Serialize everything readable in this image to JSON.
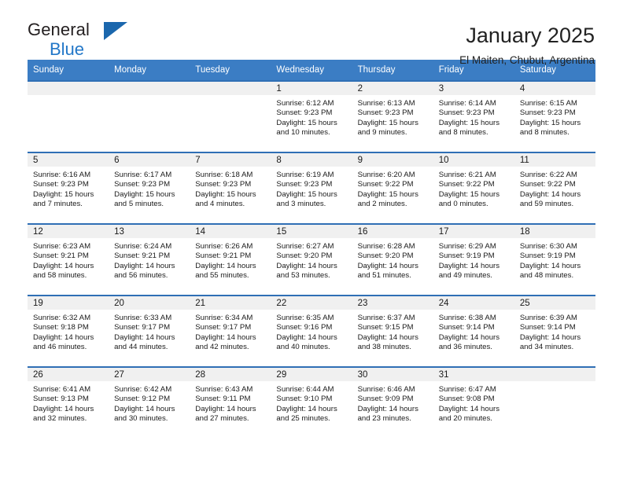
{
  "brand": {
    "name_top": "General",
    "name_bottom": "Blue",
    "triangle_color": "#1b67ad",
    "blue_text_color": "#2277c8"
  },
  "header": {
    "title": "January 2025",
    "subtitle": "El Maiten, Chubut, Argentina"
  },
  "theme": {
    "header_bg": "#3b7dc4",
    "row_border": "#2f6fb5",
    "day_strip_bg": "#f0f0f0"
  },
  "weekdays": [
    "Sunday",
    "Monday",
    "Tuesday",
    "Wednesday",
    "Thursday",
    "Friday",
    "Saturday"
  ],
  "labels": {
    "sunrise": "Sunrise:",
    "sunset": "Sunset:",
    "daylight": "Daylight:"
  },
  "weeks": [
    [
      {
        "day": "",
        "empty": true
      },
      {
        "day": "",
        "empty": true
      },
      {
        "day": "",
        "empty": true
      },
      {
        "day": "1",
        "sunrise": "Sunrise: 6:12 AM",
        "sunset": "Sunset: 9:23 PM",
        "daylight_line1": "Daylight: 15 hours",
        "daylight_line2": "and 10 minutes."
      },
      {
        "day": "2",
        "sunrise": "Sunrise: 6:13 AM",
        "sunset": "Sunset: 9:23 PM",
        "daylight_line1": "Daylight: 15 hours",
        "daylight_line2": "and 9 minutes."
      },
      {
        "day": "3",
        "sunrise": "Sunrise: 6:14 AM",
        "sunset": "Sunset: 9:23 PM",
        "daylight_line1": "Daylight: 15 hours",
        "daylight_line2": "and 8 minutes."
      },
      {
        "day": "4",
        "sunrise": "Sunrise: 6:15 AM",
        "sunset": "Sunset: 9:23 PM",
        "daylight_line1": "Daylight: 15 hours",
        "daylight_line2": "and 8 minutes."
      }
    ],
    [
      {
        "day": "5",
        "sunrise": "Sunrise: 6:16 AM",
        "sunset": "Sunset: 9:23 PM",
        "daylight_line1": "Daylight: 15 hours",
        "daylight_line2": "and 7 minutes."
      },
      {
        "day": "6",
        "sunrise": "Sunrise: 6:17 AM",
        "sunset": "Sunset: 9:23 PM",
        "daylight_line1": "Daylight: 15 hours",
        "daylight_line2": "and 5 minutes."
      },
      {
        "day": "7",
        "sunrise": "Sunrise: 6:18 AM",
        "sunset": "Sunset: 9:23 PM",
        "daylight_line1": "Daylight: 15 hours",
        "daylight_line2": "and 4 minutes."
      },
      {
        "day": "8",
        "sunrise": "Sunrise: 6:19 AM",
        "sunset": "Sunset: 9:23 PM",
        "daylight_line1": "Daylight: 15 hours",
        "daylight_line2": "and 3 minutes."
      },
      {
        "day": "9",
        "sunrise": "Sunrise: 6:20 AM",
        "sunset": "Sunset: 9:22 PM",
        "daylight_line1": "Daylight: 15 hours",
        "daylight_line2": "and 2 minutes."
      },
      {
        "day": "10",
        "sunrise": "Sunrise: 6:21 AM",
        "sunset": "Sunset: 9:22 PM",
        "daylight_line1": "Daylight: 15 hours",
        "daylight_line2": "and 0 minutes."
      },
      {
        "day": "11",
        "sunrise": "Sunrise: 6:22 AM",
        "sunset": "Sunset: 9:22 PM",
        "daylight_line1": "Daylight: 14 hours",
        "daylight_line2": "and 59 minutes."
      }
    ],
    [
      {
        "day": "12",
        "sunrise": "Sunrise: 6:23 AM",
        "sunset": "Sunset: 9:21 PM",
        "daylight_line1": "Daylight: 14 hours",
        "daylight_line2": "and 58 minutes."
      },
      {
        "day": "13",
        "sunrise": "Sunrise: 6:24 AM",
        "sunset": "Sunset: 9:21 PM",
        "daylight_line1": "Daylight: 14 hours",
        "daylight_line2": "and 56 minutes."
      },
      {
        "day": "14",
        "sunrise": "Sunrise: 6:26 AM",
        "sunset": "Sunset: 9:21 PM",
        "daylight_line1": "Daylight: 14 hours",
        "daylight_line2": "and 55 minutes."
      },
      {
        "day": "15",
        "sunrise": "Sunrise: 6:27 AM",
        "sunset": "Sunset: 9:20 PM",
        "daylight_line1": "Daylight: 14 hours",
        "daylight_line2": "and 53 minutes."
      },
      {
        "day": "16",
        "sunrise": "Sunrise: 6:28 AM",
        "sunset": "Sunset: 9:20 PM",
        "daylight_line1": "Daylight: 14 hours",
        "daylight_line2": "and 51 minutes."
      },
      {
        "day": "17",
        "sunrise": "Sunrise: 6:29 AM",
        "sunset": "Sunset: 9:19 PM",
        "daylight_line1": "Daylight: 14 hours",
        "daylight_line2": "and 49 minutes."
      },
      {
        "day": "18",
        "sunrise": "Sunrise: 6:30 AM",
        "sunset": "Sunset: 9:19 PM",
        "daylight_line1": "Daylight: 14 hours",
        "daylight_line2": "and 48 minutes."
      }
    ],
    [
      {
        "day": "19",
        "sunrise": "Sunrise: 6:32 AM",
        "sunset": "Sunset: 9:18 PM",
        "daylight_line1": "Daylight: 14 hours",
        "daylight_line2": "and 46 minutes."
      },
      {
        "day": "20",
        "sunrise": "Sunrise: 6:33 AM",
        "sunset": "Sunset: 9:17 PM",
        "daylight_line1": "Daylight: 14 hours",
        "daylight_line2": "and 44 minutes."
      },
      {
        "day": "21",
        "sunrise": "Sunrise: 6:34 AM",
        "sunset": "Sunset: 9:17 PM",
        "daylight_line1": "Daylight: 14 hours",
        "daylight_line2": "and 42 minutes."
      },
      {
        "day": "22",
        "sunrise": "Sunrise: 6:35 AM",
        "sunset": "Sunset: 9:16 PM",
        "daylight_line1": "Daylight: 14 hours",
        "daylight_line2": "and 40 minutes."
      },
      {
        "day": "23",
        "sunrise": "Sunrise: 6:37 AM",
        "sunset": "Sunset: 9:15 PM",
        "daylight_line1": "Daylight: 14 hours",
        "daylight_line2": "and 38 minutes."
      },
      {
        "day": "24",
        "sunrise": "Sunrise: 6:38 AM",
        "sunset": "Sunset: 9:14 PM",
        "daylight_line1": "Daylight: 14 hours",
        "daylight_line2": "and 36 minutes."
      },
      {
        "day": "25",
        "sunrise": "Sunrise: 6:39 AM",
        "sunset": "Sunset: 9:14 PM",
        "daylight_line1": "Daylight: 14 hours",
        "daylight_line2": "and 34 minutes."
      }
    ],
    [
      {
        "day": "26",
        "sunrise": "Sunrise: 6:41 AM",
        "sunset": "Sunset: 9:13 PM",
        "daylight_line1": "Daylight: 14 hours",
        "daylight_line2": "and 32 minutes."
      },
      {
        "day": "27",
        "sunrise": "Sunrise: 6:42 AM",
        "sunset": "Sunset: 9:12 PM",
        "daylight_line1": "Daylight: 14 hours",
        "daylight_line2": "and 30 minutes."
      },
      {
        "day": "28",
        "sunrise": "Sunrise: 6:43 AM",
        "sunset": "Sunset: 9:11 PM",
        "daylight_line1": "Daylight: 14 hours",
        "daylight_line2": "and 27 minutes."
      },
      {
        "day": "29",
        "sunrise": "Sunrise: 6:44 AM",
        "sunset": "Sunset: 9:10 PM",
        "daylight_line1": "Daylight: 14 hours",
        "daylight_line2": "and 25 minutes."
      },
      {
        "day": "30",
        "sunrise": "Sunrise: 6:46 AM",
        "sunset": "Sunset: 9:09 PM",
        "daylight_line1": "Daylight: 14 hours",
        "daylight_line2": "and 23 minutes."
      },
      {
        "day": "31",
        "sunrise": "Sunrise: 6:47 AM",
        "sunset": "Sunset: 9:08 PM",
        "daylight_line1": "Daylight: 14 hours",
        "daylight_line2": "and 20 minutes."
      },
      {
        "day": "",
        "empty": true
      }
    ]
  ]
}
